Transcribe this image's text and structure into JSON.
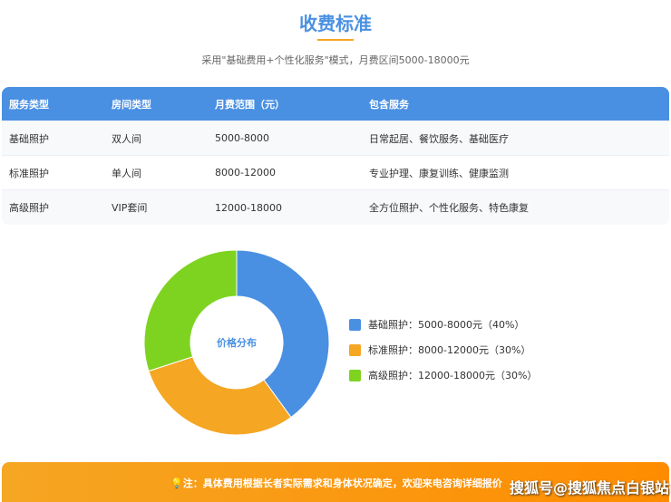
{
  "title": "收费标准",
  "subtitle": "采用\"基础费用+个性化服务\"模式，月费区间5000-18000元",
  "table": {
    "headers": [
      "服务类型",
      "房间类型",
      "月费范围（元）",
      "包含服务"
    ],
    "rows": [
      [
        "基础照护",
        "双人间",
        "5000-8000",
        "日常起居、餐饮服务、基础医疗"
      ],
      [
        "标准照护",
        "单人间",
        "8000-12000",
        "专业护理、康复训练、健康监测"
      ],
      [
        "高级照护",
        "VIP套间",
        "12000-18000",
        "全方位照护、个性化服务、特色康复"
      ]
    ]
  },
  "chart_data": {
    "type": "pie",
    "title": "价格分布",
    "categories": [
      "基础照护",
      "标准照护",
      "高级照护"
    ],
    "values": [
      40,
      30,
      30
    ],
    "colors": [
      "#4a90e2",
      "#f5a623",
      "#7ed321"
    ],
    "legend": [
      "基础照护：5000-8000元（40%）",
      "标准照护：8000-12000元（30%）",
      "高级照护：12000-18000元（30%）"
    ],
    "legend_position": "right"
  },
  "footer": {
    "note": "注：具体费用根据长者实际需求和身体状况确定，欢迎来电咨询详细报价",
    "watermark": "搜狐号@搜狐焦点白银站"
  }
}
